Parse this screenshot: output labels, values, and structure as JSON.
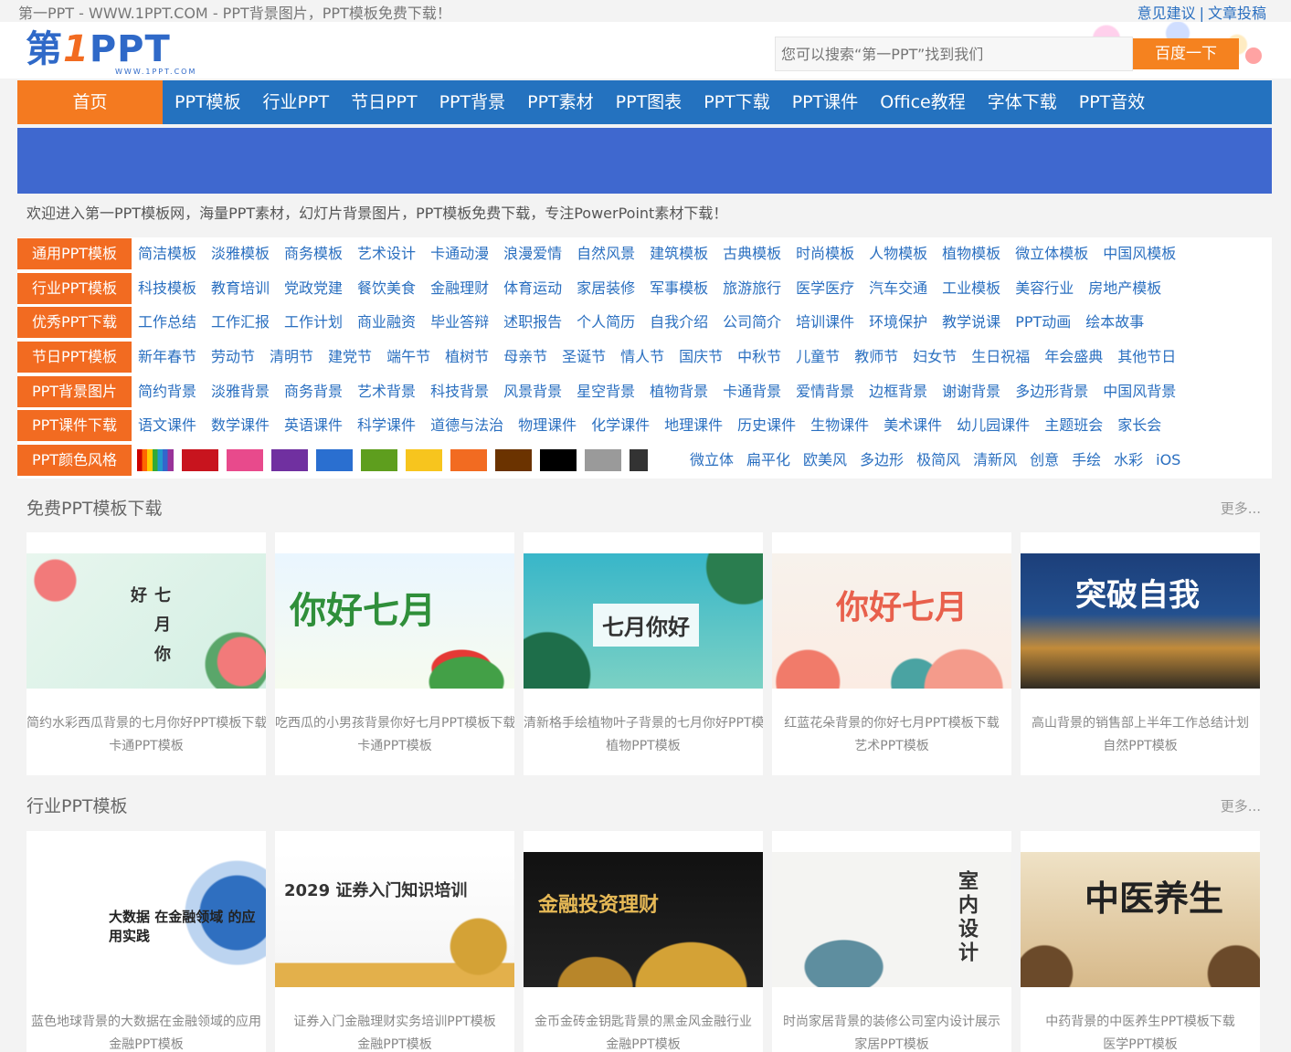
{
  "topbar": {
    "site_title": "第一PPT - WWW.1PPT.COM - PPT背景图片，PPT模板免费下载！",
    "link_feedback": "意见建议",
    "separator": "|",
    "link_submit": "文章投稿"
  },
  "header": {
    "logo_part1": "第",
    "logo_part2": "1",
    "logo_part3": "PPT",
    "logo_url": "WWW.1PPT.COM",
    "search_placeholder": "您可以搜索“第一PPT”找到我们",
    "search_button": "百度一下"
  },
  "nav": {
    "home": "首页",
    "items": [
      "PPT模板",
      "行业PPT",
      "节日PPT",
      "PPT背景",
      "PPT素材",
      "PPT图表",
      "PPT下载",
      "PPT课件",
      "Office教程",
      "字体下载",
      "PPT音效"
    ]
  },
  "welcome": "欢迎进入第一PPT模板网，海量PPT素材，幻灯片背景图片，PPT模板免费下载，专注PowerPoint素材下载！",
  "categories": [
    {
      "label": "通用PPT模板",
      "links": [
        "简洁模板",
        "淡雅模板",
        "商务模板",
        "艺术设计",
        "卡通动漫",
        "浪漫爱情",
        "自然风景",
        "建筑模板",
        "古典模板",
        "时尚模板",
        "人物模板",
        "植物模板",
        "微立体模板",
        "中国风模板"
      ]
    },
    {
      "label": "行业PPT模板",
      "links": [
        "科技模板",
        "教育培训",
        "党政党建",
        "餐饮美食",
        "金融理财",
        "体育运动",
        "家居装修",
        "军事模板",
        "旅游旅行",
        "医学医疗",
        "汽车交通",
        "工业模板",
        "美容行业",
        "房地产模板"
      ]
    },
    {
      "label": "优秀PPT下载",
      "links": [
        "工作总结",
        "工作汇报",
        "工作计划",
        "商业融资",
        "毕业答辩",
        "述职报告",
        "个人简历",
        "自我介绍",
        "公司简介",
        "培训课件",
        "环境保护",
        "教学说课",
        "PPT动画",
        "绘本故事"
      ]
    },
    {
      "label": "节日PPT模板",
      "links": [
        "新年春节",
        "劳动节",
        "清明节",
        "建党节",
        "端午节",
        "植树节",
        "母亲节",
        "圣诞节",
        "情人节",
        "国庆节",
        "中秋节",
        "儿童节",
        "教师节",
        "妇女节",
        "生日祝福",
        "年会盛典",
        "其他节日"
      ]
    },
    {
      "label": "PPT背景图片",
      "links": [
        "简约背景",
        "淡雅背景",
        "商务背景",
        "艺术背景",
        "科技背景",
        "风景背景",
        "星空背景",
        "植物背景",
        "卡通背景",
        "爱情背景",
        "边框背景",
        "谢谢背景",
        "多边形背景",
        "中国风背景"
      ]
    },
    {
      "label": "PPT课件下载",
      "links": [
        "语文课件",
        "数学课件",
        "英语课件",
        "科学课件",
        "道德与法治",
        "物理课件",
        "化学课件",
        "地理课件",
        "历史课件",
        "生物课件",
        "美术课件",
        "幼儿园课件",
        "主题班会",
        "家长会"
      ]
    }
  ],
  "color_row": {
    "label": "PPT颜色风格",
    "swatches": [
      "rainbow",
      "#c8141e",
      "#e84a8c",
      "#7030a0",
      "#2a6fd0",
      "#5e9e1e",
      "#f7c51e",
      "#f26b21",
      "#6b3300",
      "#000000",
      "#9a9a9a",
      "black-white"
    ],
    "style_links": [
      "微立体",
      "扁平化",
      "欧美风",
      "多边形",
      "极简风",
      "清新风",
      "创意",
      "手绘",
      "水彩",
      "iOS"
    ]
  },
  "sections": [
    {
      "title": "免费PPT模板下载",
      "more": "更多...",
      "cards": [
        {
          "title": "简约水彩西瓜背景的七月你好PPT模板下载",
          "category": "卡通PPT模板",
          "thumb_text": "七 月 你 好"
        },
        {
          "title": "吃西瓜的小男孩背景你好七月PPT模板下载",
          "category": "卡通PPT模板",
          "thumb_text": "你好七月"
        },
        {
          "title": "清新格手绘植物叶子背景的七月你好PPT模板",
          "category": "植物PPT模板",
          "thumb_text": "七月你好"
        },
        {
          "title": "红蓝花朵背景的你好七月PPT模板下载",
          "category": "艺术PPT模板",
          "thumb_text": "你好七月"
        },
        {
          "title": "高山背景的销售部上半年工作总结计划",
          "category": "自然PPT模板",
          "thumb_text": "突破自我"
        }
      ]
    },
    {
      "title": "行业PPT模板",
      "more": "更多...",
      "cards": [
        {
          "title": "蓝色地球背景的大数据在金融领域的应用",
          "category": "金融PPT模板",
          "thumb_text": "大数据 在金融领域 的应用实践"
        },
        {
          "title": "证券入门金融理财实务培训PPT模板",
          "category": "金融PPT模板",
          "thumb_text": "2029 证券入门知识培训"
        },
        {
          "title": "金币金砖金钥匙背景的黑金风金融行业",
          "category": "金融PPT模板",
          "thumb_text": "金融投资理财"
        },
        {
          "title": "时尚家居背景的装修公司室内设计展示",
          "category": "家居PPT模板",
          "thumb_text": "室内设计"
        },
        {
          "title": "中药背景的中医养生PPT模板下载",
          "category": "医学PPT模板",
          "thumb_text": "中医养生"
        }
      ]
    }
  ]
}
